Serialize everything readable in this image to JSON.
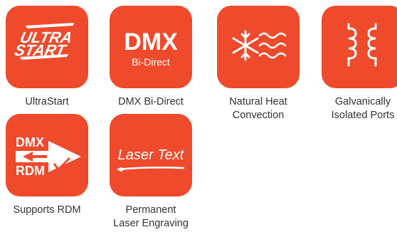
{
  "brand": {
    "accent": "#ee4a2b",
    "icon_fg": "#ffffff",
    "caption_color": "#333333"
  },
  "features": [
    {
      "icon": "ultrastart-icon",
      "icon_text_line1": "ULTRA",
      "icon_text_line2": "START",
      "caption": "UltraStart"
    },
    {
      "icon": "dmx-bidirect-icon",
      "icon_text_line1": "DMX",
      "icon_text_line2": "Bi-Direct",
      "caption": "DMX Bi-Direct"
    },
    {
      "icon": "heat-convection-icon",
      "caption": "Natural Heat\nConvection"
    },
    {
      "icon": "isolation-coil-icon",
      "caption": "Galvanically\nIsolated Ports"
    },
    {
      "icon": "rdm-icon",
      "icon_text_line1": "DMX",
      "icon_text_line2": "RDM",
      "caption": "Supports RDM"
    },
    {
      "icon": "laser-text-icon",
      "icon_text_line1": "Laser Text",
      "caption": "Permanent\nLaser Engraving"
    }
  ]
}
